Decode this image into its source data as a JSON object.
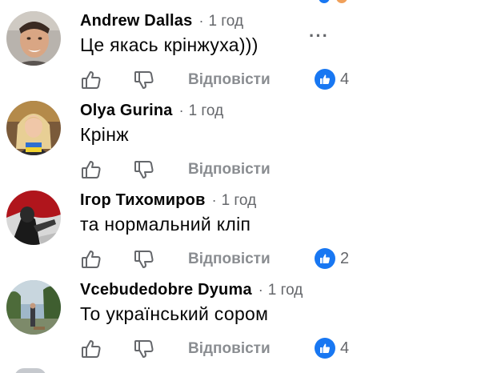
{
  "comments": [
    {
      "author": "Andrew Dallas",
      "separator": "·",
      "time": "1 год",
      "text": "Це якась крінжуха)))",
      "reply_label": "Відповісти",
      "reactions": "4",
      "more": "···"
    },
    {
      "author": "Olya Gurina",
      "separator": "·",
      "time": "1 год",
      "text": "Крінж",
      "reply_label": "Відповісти"
    },
    {
      "author": "Ігор Тихомиров",
      "separator": "·",
      "time": "1 год",
      "text": "та нормальний кліп",
      "reply_label": "Відповісти",
      "reactions": "2"
    },
    {
      "author": "Vcebudedobre Dyuma",
      "separator": "·",
      "time": "1 год",
      "text": "То український сором",
      "reply_label": "Відповісти",
      "reactions": "4"
    }
  ],
  "icons": {
    "like": "thumbs-up-icon",
    "dislike": "thumbs-down-icon",
    "reaction": "like-reaction-icon",
    "more": "more-options-icon"
  },
  "colors": {
    "like_blue": "#1877f2",
    "meta_gray": "#65676b",
    "action_gray": "#8a8d91",
    "text": "#050505"
  }
}
